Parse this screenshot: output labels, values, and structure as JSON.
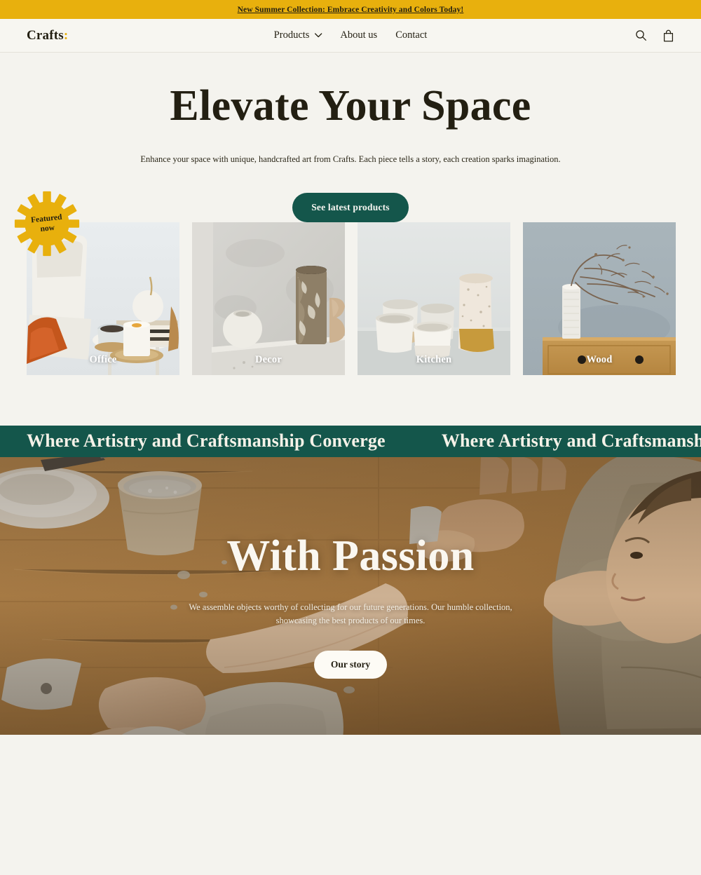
{
  "announcement": {
    "text": "New Summer Collection: Embrace Creativity and Colors Today!",
    "bg_color": "#e8b00d"
  },
  "header": {
    "logo": "Crafts",
    "logo_accent": ":",
    "nav": [
      {
        "label": "Products",
        "has_dropdown": true
      },
      {
        "label": "About us",
        "has_dropdown": false
      },
      {
        "label": "Contact",
        "has_dropdown": false
      }
    ],
    "actions": [
      {
        "icon": "search-icon"
      },
      {
        "icon": "shopping-bag-icon"
      }
    ]
  },
  "hero": {
    "title": "Elevate Your Space",
    "subtitle": "Enhance your space with unique, handcrafted art from Crafts. Each piece tells a story, each creation sparks imagination.",
    "cta_label": "See latest products",
    "cta_color": "#14564b"
  },
  "badge": {
    "line1": "Featured",
    "line2": "now",
    "color": "#e8b00d"
  },
  "categories": [
    {
      "label": "Office"
    },
    {
      "label": "Decor"
    },
    {
      "label": "Kitchen"
    },
    {
      "label": "Wood"
    }
  ],
  "marquee": {
    "text": "Where Artistry and Craftsmanship Converge",
    "bg_color": "#14564b",
    "repeats": [
      "Where Artistry and Craftsmanship Converge",
      "Where Artistry and Craftsmanship Converge"
    ]
  },
  "story": {
    "title": "With Passion",
    "subtitle": "We assemble objects worthy of collecting for our future generations. Our humble collection, showcasing the best products of our times.",
    "cta_label": "Our story"
  }
}
